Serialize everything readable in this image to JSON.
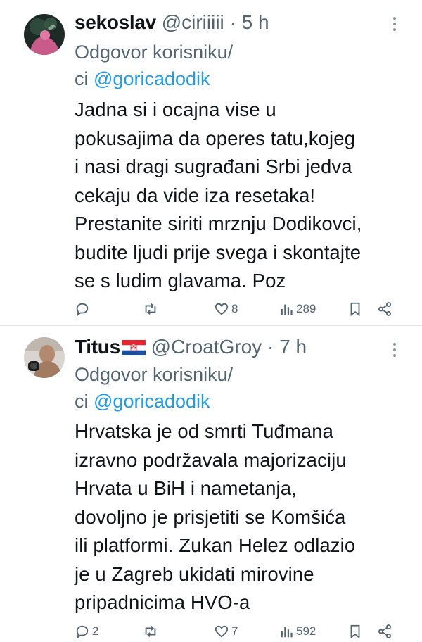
{
  "tweets": [
    {
      "name": "sekoslav",
      "handle": "@ciriiiii",
      "dot": "·",
      "time": "5 h",
      "reply_label": "Odgovor korisniku/",
      "reply_prefix": "ci",
      "reply_mention": "@goricadodik",
      "text": "Jadna si i ocajna vise u\npokusajima da operes tatu,kojeg\ni nasi dragi sugrađani Srbi jedva\ncekaju da vide iza resetaka!\nPrestanite siriti mrznju Dodikovci,\nbudite ljudi prije svega i skontajte\nse s ludim glavama. Poz",
      "counts": {
        "replies": "",
        "retweets": "",
        "likes": "8",
        "views": "289"
      }
    },
    {
      "name": "Titus",
      "handle": "@CroatGroy",
      "dot": "·",
      "time": "7 h",
      "reply_label": "Odgovor korisniku/",
      "reply_prefix": "ci",
      "reply_mention": "@goricadodik",
      "text": "Hrvatska je od smrti Tuđmana\nizravno podržavala majorizaciju\nHrvata u BiH i nametanja,\ndovoljno je prisjetiti se Komšića\nili platformi. Zukan Helez odlazio\nje u Zagreb ukidati mirovine\npripadnicima HVO-a",
      "counts": {
        "replies": "2",
        "retweets": "",
        "likes": "7",
        "views": "592"
      }
    }
  ],
  "colors": {
    "text": "#0f1419",
    "secondary": "#536471",
    "link": "#1d9bf0"
  },
  "icons": [
    "reply-icon",
    "retweet-icon",
    "heart-icon",
    "views-icon",
    "bookmark-icon",
    "share-icon",
    "more-icon",
    "croatia-flag-icon"
  ]
}
